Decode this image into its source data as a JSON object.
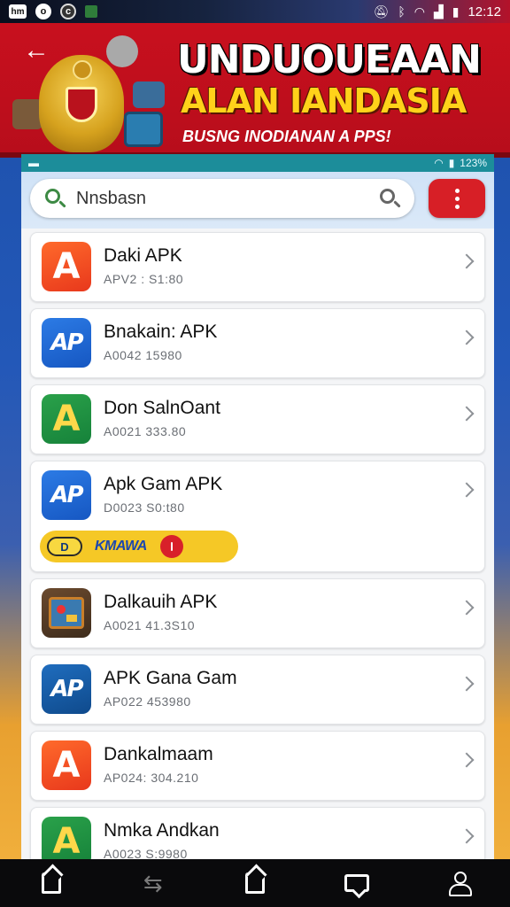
{
  "status_bar": {
    "left_badge": "hm",
    "left_circle1": "o",
    "left_circle2": "c",
    "time": "12:12",
    "icons": [
      "mute-icon",
      "bluetooth-icon",
      "wifi-icon",
      "signal-icon",
      "battery-icon"
    ]
  },
  "banner": {
    "title_line1": "UNDUOUEAAN",
    "title_line2": "ALAN IANDASIA",
    "subtitle": "BUSNG INODIANAN A PPS!"
  },
  "inner_status": {
    "battery_text": "123%"
  },
  "search": {
    "placeholder": "Nnsbasn"
  },
  "apps": [
    {
      "name": "Daki APK",
      "meta": "APV2 : S1:80",
      "icon": "orange-a-icon",
      "color": "#f05a24"
    },
    {
      "name": "Bnakain: APK",
      "meta": "A0042 15980",
      "icon": "blue-ap-icon",
      "color": "#1f6fd8"
    },
    {
      "name": "Don SalnOant",
      "meta": "A0021 333.80",
      "icon": "green-triangle-icon",
      "color": "#22963f"
    },
    {
      "name": "Apk Gam APK",
      "meta": "D0023 S0:t80",
      "icon": "blue-ap-icon",
      "color": "#1f6fd8",
      "promo": {
        "chip": "D",
        "label": "KMAWA"
      }
    },
    {
      "name": "Dalkauih APK",
      "meta": "A0021 41.3S10",
      "icon": "game-icon",
      "color": "#5a3e26"
    },
    {
      "name": "APK Gana Gam",
      "meta": "AP022 453980",
      "icon": "blue-ap-icon",
      "color": "#17589e"
    },
    {
      "name": "Dankalmaam",
      "meta": "AP024: 304.210",
      "icon": "orange-a-icon",
      "color": "#f05a24"
    },
    {
      "name": "Nmka Andkan",
      "meta": "A0023 S:9980",
      "icon": "green-triangle-icon",
      "color": "#22963f"
    }
  ],
  "colors": {
    "banner_red": "#c8101e",
    "accent_red": "#d71f26",
    "title_yellow": "#ffd21a",
    "inner_teal": "#1c8d9a"
  },
  "nav": {
    "items": [
      "home-icon",
      "back-icon",
      "house-icon",
      "chat-icon",
      "profile-icon"
    ]
  }
}
